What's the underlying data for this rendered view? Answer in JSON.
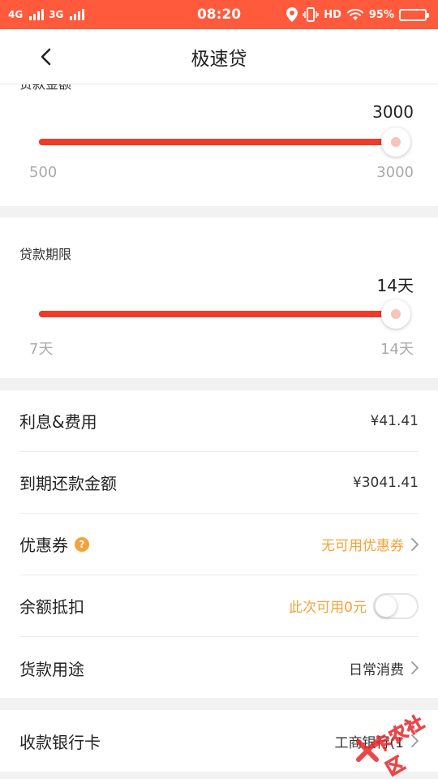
{
  "status_bar": {
    "net1": "4G",
    "net2": "3G",
    "time": "08:20",
    "hd": "HD",
    "battery": "95%"
  },
  "navbar": {
    "title": "极速贷"
  },
  "amount": {
    "label": "贷款金额",
    "value": "3000",
    "min": "500",
    "max": "3000",
    "fraction": 1.0
  },
  "term": {
    "label": "贷款期限",
    "value": "14天",
    "min": "7天",
    "max": "14天",
    "fraction": 1.0
  },
  "details": {
    "interest_label": "利息&费用",
    "interest_value": "¥41.41",
    "due_label": "到期还款金额",
    "due_value": "¥3041.41",
    "coupon_label": "优惠券",
    "coupon_value": "无可用优惠券",
    "balance_label": "余额抵扣",
    "balance_value": "此次可用0元",
    "purpose_label": "货款用途",
    "purpose_value": "日常消费"
  },
  "bank": {
    "label": "收款银行卡",
    "value": "工商银行(1"
  },
  "watermark": "卡农社区",
  "colors": {
    "status_bar": "#ff5a3c",
    "slider": "#f23a28",
    "accent_orange": "#f5a23a"
  },
  "icons": [
    "back-arrow-icon",
    "help-icon",
    "chevron-right-icon",
    "location-icon",
    "vibrate-icon",
    "wifi-icon",
    "battery-icon"
  ]
}
